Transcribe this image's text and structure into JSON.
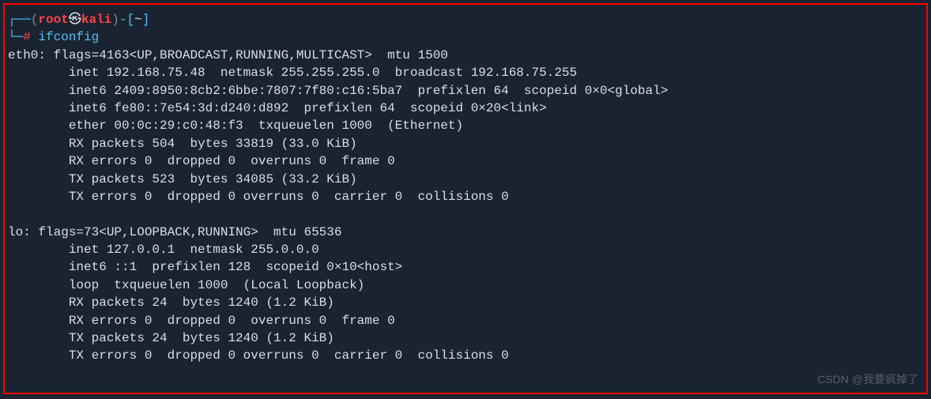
{
  "prompt": {
    "box_top_open": "┌──",
    "paren_open": "(",
    "user": "root",
    "skull": "㉿",
    "host": "kali",
    "paren_close": ")",
    "dash": "-",
    "bracket_open": "[",
    "path": "~",
    "bracket_close": "]",
    "box_bottom": "└─",
    "hash": "#",
    "command": "ifconfig"
  },
  "eth0": {
    "header": "eth0: flags=4163<UP,BROADCAST,RUNNING,MULTICAST>  mtu 1500",
    "inet": "        inet 192.168.75.48  netmask 255.255.255.0  broadcast 192.168.75.255",
    "inet6_global": "        inet6 2409:8950:8cb2:6bbe:7807:7f80:c16:5ba7  prefixlen 64  scopeid 0×0<global>",
    "inet6_link": "        inet6 fe80::7e54:3d:d240:d892  prefixlen 64  scopeid 0×20<link>",
    "ether": "        ether 00:0c:29:c0:48:f3  txqueuelen 1000  (Ethernet)",
    "rx_packets": "        RX packets 504  bytes 33819 (33.0 KiB)",
    "rx_errors": "        RX errors 0  dropped 0  overruns 0  frame 0",
    "tx_packets": "        TX packets 523  bytes 34085 (33.2 KiB)",
    "tx_errors": "        TX errors 0  dropped 0 overruns 0  carrier 0  collisions 0"
  },
  "lo": {
    "header": "lo: flags=73<UP,LOOPBACK,RUNNING>  mtu 65536",
    "inet": "        inet 127.0.0.1  netmask 255.0.0.0",
    "inet6": "        inet6 ::1  prefixlen 128  scopeid 0×10<host>",
    "loop": "        loop  txqueuelen 1000  (Local Loopback)",
    "rx_packets": "        RX packets 24  bytes 1240 (1.2 KiB)",
    "rx_errors": "        RX errors 0  dropped 0  overruns 0  frame 0",
    "tx_packets": "        TX packets 24  bytes 1240 (1.2 KiB)",
    "tx_errors": "        TX errors 0  dropped 0 overruns 0  carrier 0  collisions 0"
  },
  "watermark": "CSDN @我要疯掉了"
}
